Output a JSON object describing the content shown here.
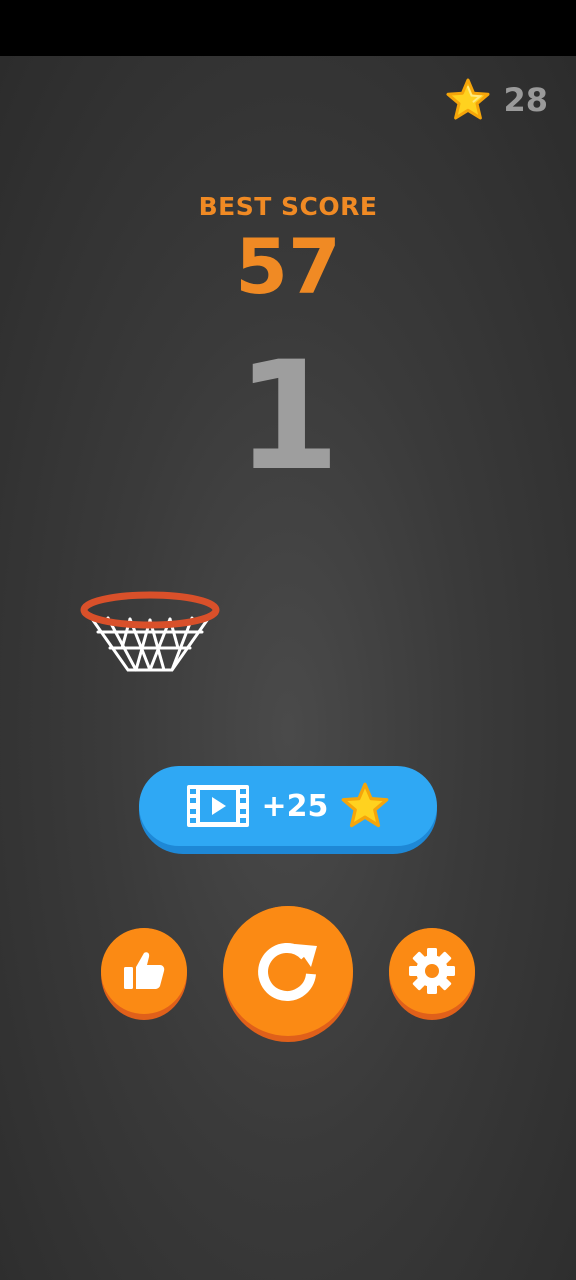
{
  "hud": {
    "stars_count": "28",
    "best_score_label": "BEST SCORE",
    "best_score_value": "57",
    "current_score": "1"
  },
  "reward": {
    "amount": "+25"
  },
  "icons": {
    "star": "star-icon",
    "video": "video-film-icon",
    "like": "thumbs-up-icon",
    "restart": "restart-icon",
    "settings": "gear-icon",
    "hoop": "basketball-hoop-icon"
  },
  "colors": {
    "accent_orange": "#f08a24",
    "button_orange": "#fb8a14",
    "button_blue": "#2fa8f4",
    "star_yellow": "#ffd21f",
    "rim_red": "#d9502a",
    "background": "#3a3a3a"
  }
}
